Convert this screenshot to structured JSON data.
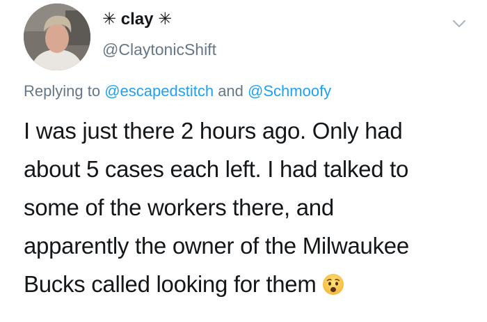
{
  "user": {
    "display_name": "✳ clay ✳",
    "handle": "@ClaytonicShift"
  },
  "icons": {
    "more": "chevron-down-icon",
    "emoji": "hushed-face-emoji"
  },
  "reply": {
    "prefix": "Replying to",
    "mention_1": "@escapedstitch",
    "conjunction": "and",
    "mention_2": "@Schmoofy"
  },
  "tweet": {
    "lines": [
      "I was just there 2 hours ago. Only had",
      "about 5 cases each left. I had talked to",
      "some of the workers there, and",
      "apparently the owner of the Milwaukee",
      "Bucks called looking for them"
    ]
  },
  "colors": {
    "text": "#14171a",
    "secondary": "#657786",
    "link": "#1da1f2"
  }
}
